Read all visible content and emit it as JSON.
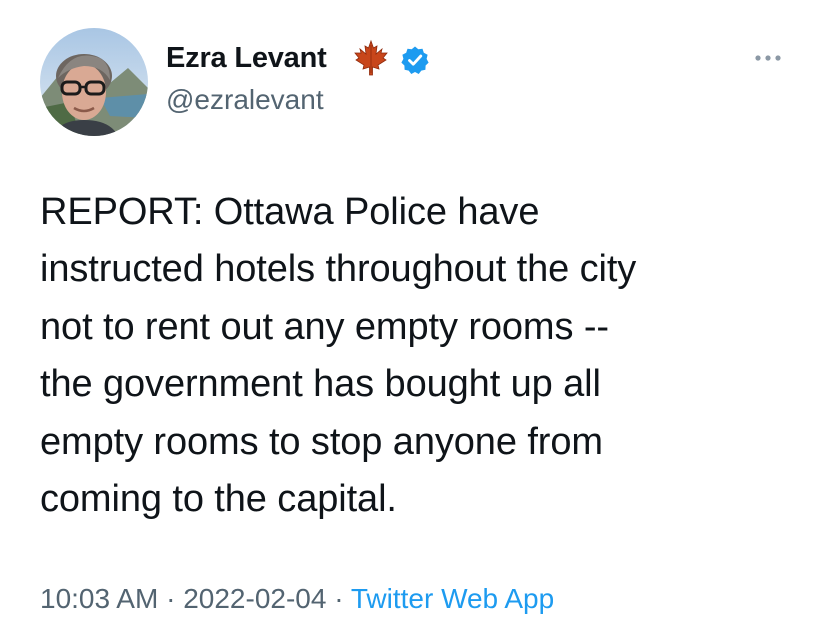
{
  "author": {
    "display_name": "Ezra Levant",
    "handle": "@ezralevant",
    "badge_icon": "maple-leaf-icon",
    "verified_icon": "verified-badge-icon",
    "verified_color": "#1d9bf0"
  },
  "tweet": {
    "text": "REPORT: Ottawa Police have\ninstructed hotels throughout the city\nnot to rent out any empty rooms --\nthe government has bought up all\nempty rooms to stop anyone from\ncoming to the capital."
  },
  "meta": {
    "time": "10:03 AM",
    "separator": " · ",
    "date": "2022-02-04",
    "source": "Twitter Web App"
  },
  "colors": {
    "text": "#0f1419",
    "secondary": "#536471",
    "link": "#1d9bf0"
  }
}
